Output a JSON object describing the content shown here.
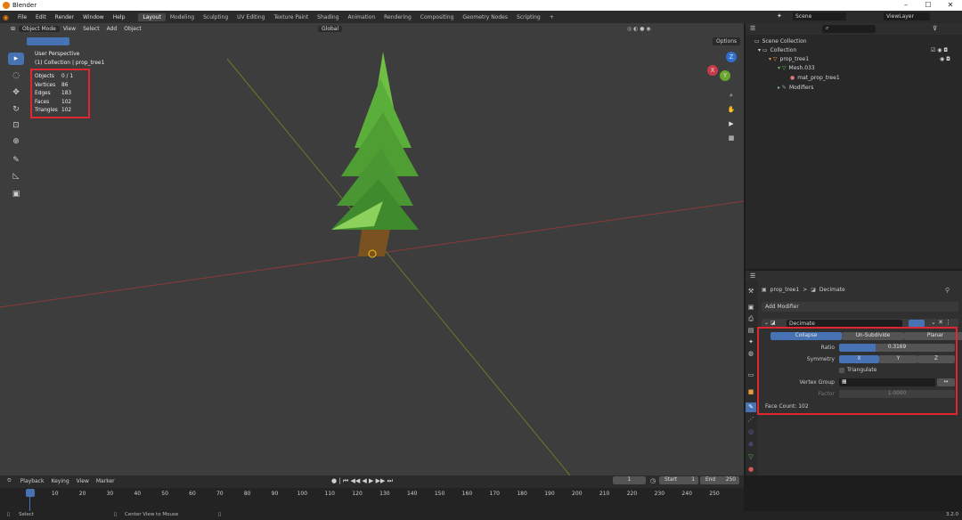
{
  "window": {
    "title": "Blender",
    "min": "–",
    "max": "☐",
    "close": "✕"
  },
  "menu": [
    "File",
    "Edit",
    "Render",
    "Window",
    "Help"
  ],
  "workspaces": [
    "Layout",
    "Modeling",
    "Sculpting",
    "UV Editing",
    "Texture Paint",
    "Shading",
    "Animation",
    "Rendering",
    "Compositing",
    "Geometry Nodes",
    "Scripting",
    "+"
  ],
  "top_right": {
    "scene": "Scene",
    "view_layer": "ViewLayer"
  },
  "viewport": {
    "mode": "Object Mode",
    "menus": [
      "View",
      "Select",
      "Add",
      "Object"
    ],
    "orientation": "Global",
    "options": "Options",
    "overlay_title": "User Perspective",
    "overlay_sub": "(1) Collection | prop_tree1",
    "stats": [
      {
        "k": "Objects",
        "v": "0 / 1"
      },
      {
        "k": "Vertices",
        "v": "86"
      },
      {
        "k": "Edges",
        "v": "183"
      },
      {
        "k": "Faces",
        "v": "102"
      },
      {
        "k": "Triangles",
        "v": "102"
      }
    ],
    "gizmo": {
      "x": "X",
      "y": "Y",
      "z": "Z"
    }
  },
  "outliner": {
    "rows": [
      "Scene Collection",
      "Collection",
      "prop_tree1",
      "Mesh.033",
      "mat_prop_tree1",
      "Modifiers"
    ]
  },
  "properties": {
    "breadcrumb_object": "prop_tree1",
    "breadcrumb_sep": ">",
    "breadcrumb_modifier": "Decimate",
    "add_modifier": "Add Modifier",
    "modifier_name": "Decimate",
    "modes": [
      "Collapse",
      "Un-Subdivide",
      "Planar"
    ],
    "ratio_label": "Ratio",
    "ratio_value": "0.3169",
    "ratio_fraction": 0.3169,
    "symmetry_label": "Symmetry",
    "axes": [
      "X",
      "Y",
      "Z"
    ],
    "triangulate": "Triangulate",
    "vertex_group_label": "Vertex Group",
    "factor_label": "Factor",
    "factor_value": "1.0000",
    "face_count": "Face Count: 102"
  },
  "timeline": {
    "menus": [
      "Playback",
      "Keying",
      "View",
      "Marker"
    ],
    "current_frame": "1",
    "start_label": "Start",
    "start": "1",
    "end_label": "End",
    "end": "250",
    "ticks": [
      "1",
      "10",
      "20",
      "30",
      "40",
      "50",
      "60",
      "70",
      "80",
      "90",
      "100",
      "110",
      "120",
      "130",
      "140",
      "150",
      "160",
      "170",
      "180",
      "190",
      "200",
      "210",
      "220",
      "230",
      "240",
      "250"
    ]
  },
  "status": {
    "select": "Select",
    "center": "Center View to Mouse",
    "version": "3.2.0"
  },
  "colors": {
    "accent": "#4772b3",
    "highlight": "#e0262e",
    "tree_dark": "#3b8a2a",
    "tree_light": "#8bd15c",
    "trunk": "#7a5222"
  }
}
